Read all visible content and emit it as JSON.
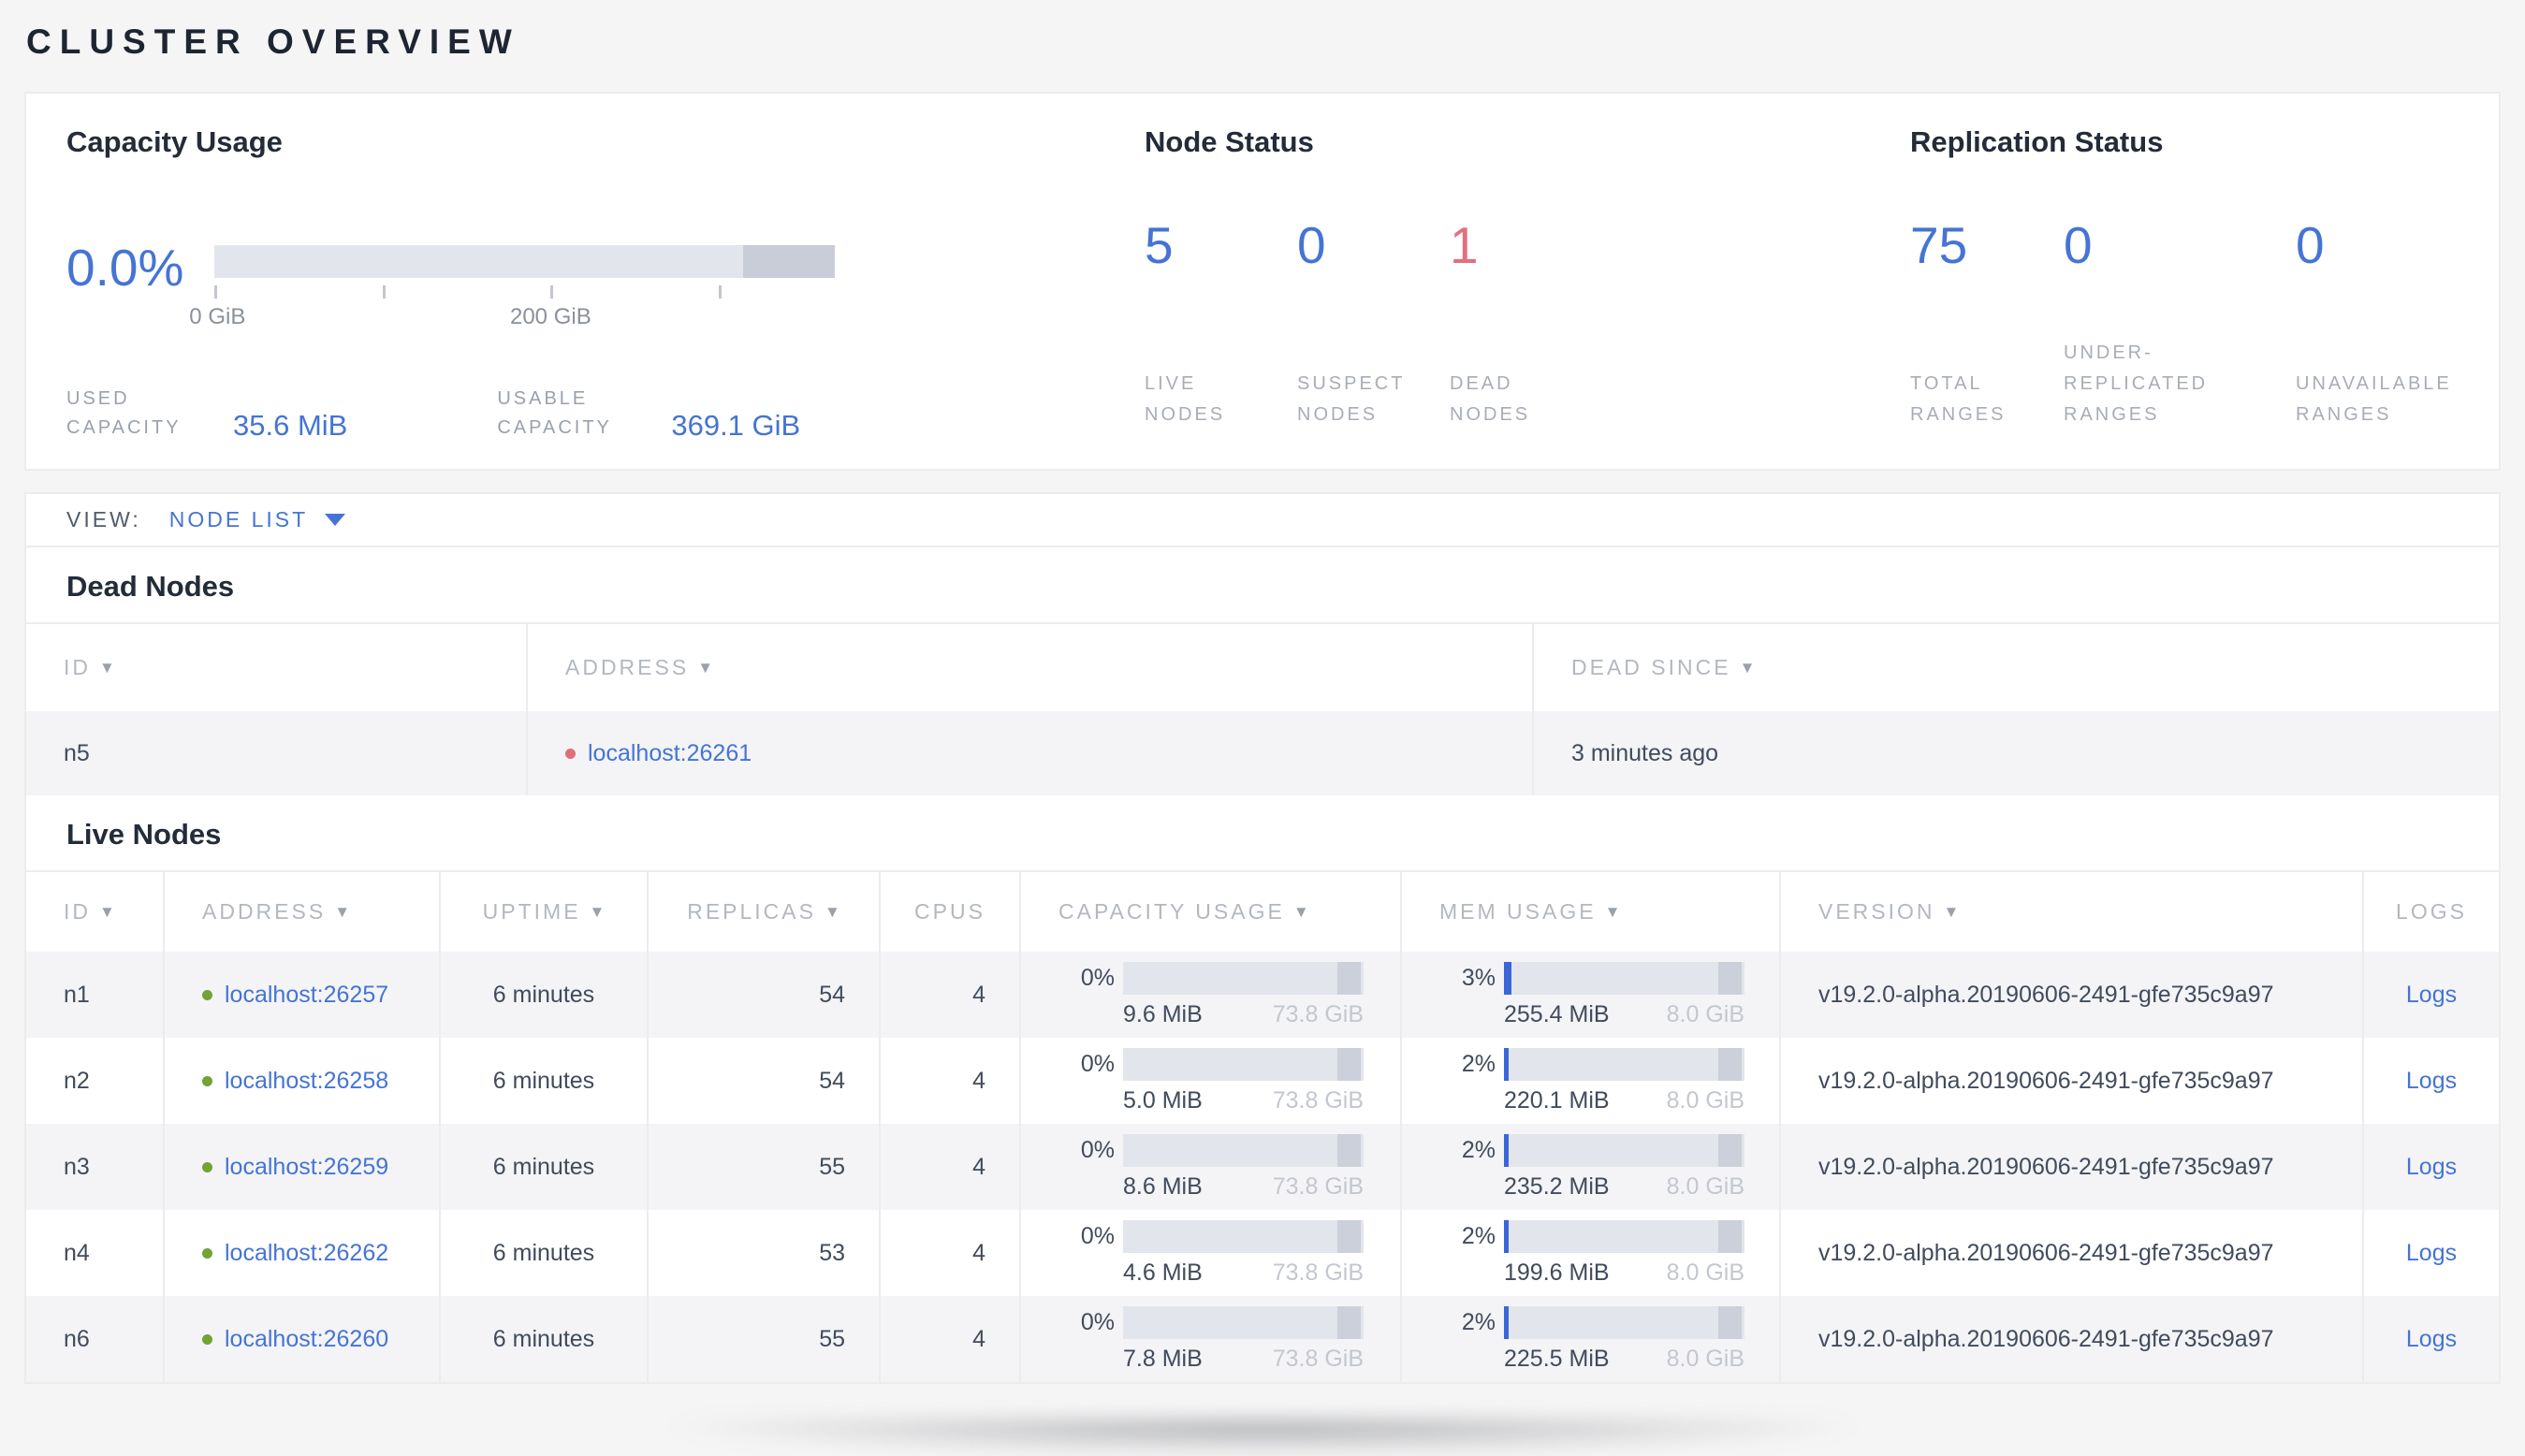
{
  "page": {
    "title": "CLUSTER OVERVIEW"
  },
  "icons": {
    "sort_arrow": "▼"
  },
  "colors": {
    "accent_blue": "#4574d4",
    "dead_red": "#e0717c",
    "live_green": "#71a335",
    "bar_track": "#e3e5ec",
    "bar_dark_segment": "#c9cdd8",
    "mem_fill_blue": "#3b66d8",
    "page_bg": "#f5f5f5",
    "alt_row_bg": "#f4f4f6"
  },
  "summary": {
    "capacity": {
      "title": "Capacity Usage",
      "percent": "0.0%",
      "axis_ticks_gib": [
        0,
        100,
        200,
        300
      ],
      "tick_label_0": "0 GiB",
      "tick_label_200": "200 GiB",
      "used_label": "USED CAPACITY",
      "used_value": "35.6 MiB",
      "usable_label": "USABLE CAPACITY",
      "usable_value": "369.1 GiB"
    },
    "node_status": {
      "title": "Node Status",
      "stats": [
        {
          "value": "5",
          "label": "LIVE NODES"
        },
        {
          "value": "0",
          "label": "SUSPECT NODES"
        },
        {
          "value": "1",
          "label": "DEAD NODES"
        }
      ]
    },
    "replication": {
      "title": "Replication Status",
      "stats": [
        {
          "value": "75",
          "label": "TOTAL RANGES"
        },
        {
          "value": "0",
          "label": "UNDER-REPLICATED RANGES"
        },
        {
          "value": "0",
          "label": "UNAVAILABLE RANGES"
        }
      ]
    }
  },
  "view_bar": {
    "label": "VIEW:",
    "selected": "NODE LIST"
  },
  "dead_nodes": {
    "title": "Dead Nodes",
    "columns": [
      {
        "label": "ID",
        "sortable": true
      },
      {
        "label": "ADDRESS",
        "sortable": true
      },
      {
        "label": "DEAD SINCE",
        "sortable": true
      }
    ],
    "rows": [
      {
        "id": "n5",
        "address": "localhost:26261",
        "dead_since": "3 minutes ago"
      }
    ]
  },
  "live_nodes": {
    "title": "Live Nodes",
    "columns": [
      {
        "label": "ID",
        "sortable": true
      },
      {
        "label": "ADDRESS",
        "sortable": true
      },
      {
        "label": "UPTIME",
        "sortable": true
      },
      {
        "label": "REPLICAS",
        "sortable": true
      },
      {
        "label": "CPUS",
        "sortable": false
      },
      {
        "label": "CAPACITY USAGE",
        "sortable": true
      },
      {
        "label": "MEM USAGE",
        "sortable": true
      },
      {
        "label": "VERSION",
        "sortable": true
      },
      {
        "label": "LOGS",
        "sortable": false
      }
    ],
    "logs_label": "Logs",
    "rows": [
      {
        "id": "n1",
        "address": "localhost:26257",
        "uptime": "6 minutes",
        "replicas": "54",
        "cpus": "4",
        "capacity_pct": "0%",
        "capacity_fill": 0,
        "capacity_used": "9.6 MiB",
        "capacity_total": "73.8 GiB",
        "mem_pct": "3%",
        "mem_fill": 3,
        "mem_used": "255.4 MiB",
        "mem_total": "8.0 GiB",
        "version": "v19.2.0-alpha.20190606-2491-gfe735c9a97"
      },
      {
        "id": "n2",
        "address": "localhost:26258",
        "uptime": "6 minutes",
        "replicas": "54",
        "cpus": "4",
        "capacity_pct": "0%",
        "capacity_fill": 0,
        "capacity_used": "5.0 MiB",
        "capacity_total": "73.8 GiB",
        "mem_pct": "2%",
        "mem_fill": 2,
        "mem_used": "220.1 MiB",
        "mem_total": "8.0 GiB",
        "version": "v19.2.0-alpha.20190606-2491-gfe735c9a97"
      },
      {
        "id": "n3",
        "address": "localhost:26259",
        "uptime": "6 minutes",
        "replicas": "55",
        "cpus": "4",
        "capacity_pct": "0%",
        "capacity_fill": 0,
        "capacity_used": "8.6 MiB",
        "capacity_total": "73.8 GiB",
        "mem_pct": "2%",
        "mem_fill": 2,
        "mem_used": "235.2 MiB",
        "mem_total": "8.0 GiB",
        "version": "v19.2.0-alpha.20190606-2491-gfe735c9a97"
      },
      {
        "id": "n4",
        "address": "localhost:26262",
        "uptime": "6 minutes",
        "replicas": "53",
        "cpus": "4",
        "capacity_pct": "0%",
        "capacity_fill": 0,
        "capacity_used": "4.6 MiB",
        "capacity_total": "73.8 GiB",
        "mem_pct": "2%",
        "mem_fill": 2,
        "mem_used": "199.6 MiB",
        "mem_total": "8.0 GiB",
        "version": "v19.2.0-alpha.20190606-2491-gfe735c9a97"
      },
      {
        "id": "n6",
        "address": "localhost:26260",
        "uptime": "6 minutes",
        "replicas": "55",
        "cpus": "4",
        "capacity_pct": "0%",
        "capacity_fill": 0,
        "capacity_used": "7.8 MiB",
        "capacity_total": "73.8 GiB",
        "mem_pct": "2%",
        "mem_fill": 2,
        "mem_used": "225.5 MiB",
        "mem_total": "8.0 GiB",
        "version": "v19.2.0-alpha.20190606-2491-gfe735c9a97"
      }
    ]
  }
}
